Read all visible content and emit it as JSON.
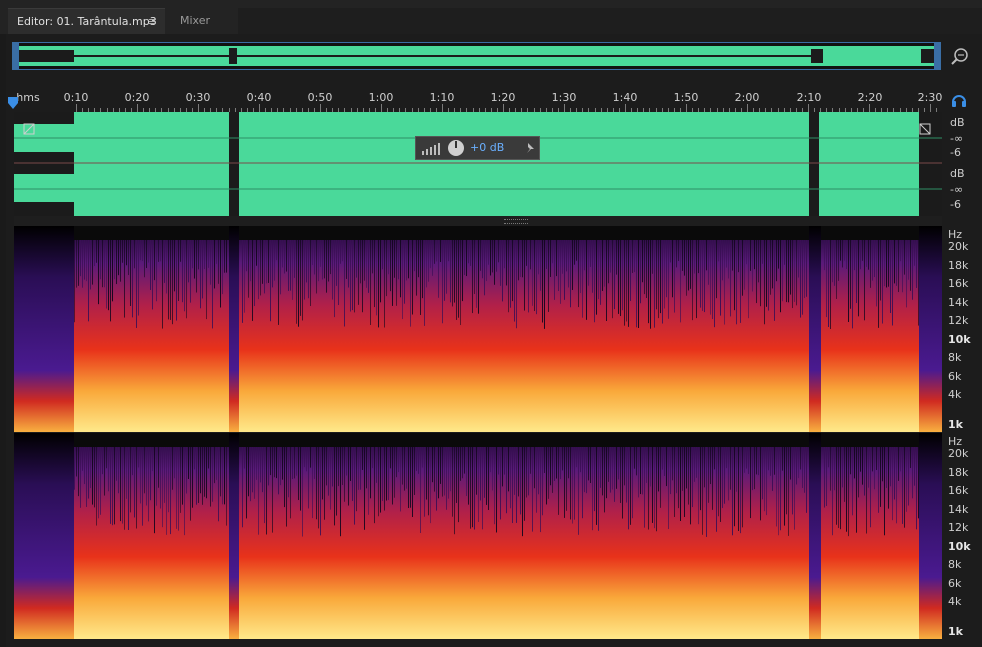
{
  "tabs": {
    "editor_label": "Editor: 01. Tarântula.mp3",
    "editor_menu": "≡",
    "mixer_label": "Mixer"
  },
  "ruler": {
    "labels": [
      "hms",
      "0:10",
      "0:20",
      "0:30",
      "0:40",
      "0:50",
      "1:00",
      "1:10",
      "1:20",
      "1:30",
      "1:40",
      "1:50",
      "2:00",
      "2:10",
      "2:20",
      "2:30"
    ]
  },
  "hud": {
    "volume": "+0 dB"
  },
  "amplitude_scale": {
    "unit_top": "dB",
    "inf_top": "-∞",
    "minus6_top": "-6",
    "unit_bot": "dB",
    "inf_bot": "-∞",
    "minus6_bot": "-6"
  },
  "spectral_scale": {
    "unit": "Hz",
    "labels": [
      "20k",
      "18k",
      "16k",
      "14k",
      "12k",
      "10k",
      "8k",
      "6k",
      "4k",
      "1k"
    ]
  },
  "colors": {
    "waveform": "#4ad99a",
    "accent": "#3a8ee6",
    "background": "#1c1c1c"
  },
  "icons": {
    "zoom": "zoom-icon",
    "headphones": "headphones-icon",
    "pin": "pin-icon",
    "knob": "knob-icon"
  }
}
